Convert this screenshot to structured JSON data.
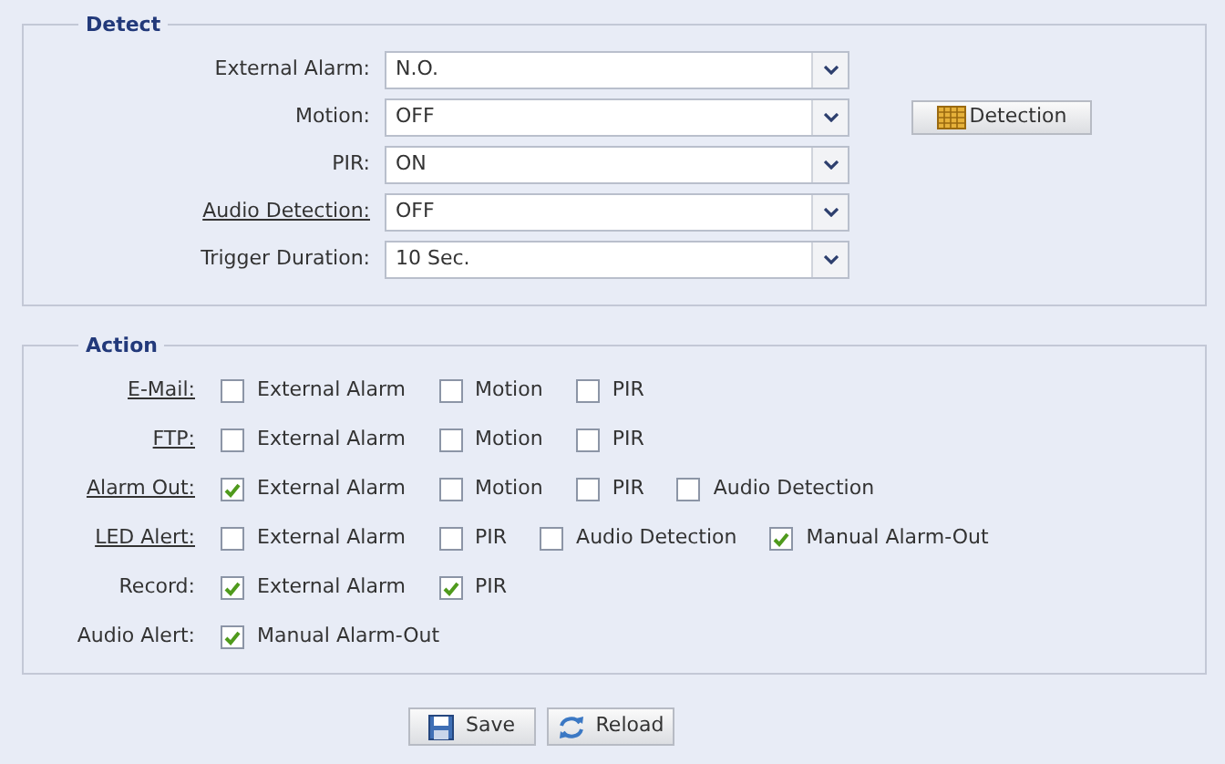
{
  "detect": {
    "legend": "Detect",
    "fields": [
      {
        "label": "External Alarm:",
        "link": false,
        "value": "N.O."
      },
      {
        "label": "Motion:",
        "link": false,
        "value": "OFF"
      },
      {
        "label": "PIR:",
        "link": false,
        "value": "ON"
      },
      {
        "label": "Audio Detection:",
        "link": true,
        "value": "OFF"
      },
      {
        "label": "Trigger Duration:",
        "link": false,
        "value": "10 Sec."
      }
    ],
    "detection_button": "Detection"
  },
  "action": {
    "legend": "Action",
    "rows": [
      {
        "label": "E-Mail:",
        "link": true,
        "options": [
          {
            "label": "External Alarm",
            "checked": false
          },
          {
            "label": "Motion",
            "checked": false
          },
          {
            "label": "PIR",
            "checked": false
          }
        ]
      },
      {
        "label": "FTP:",
        "link": true,
        "options": [
          {
            "label": "External Alarm",
            "checked": false
          },
          {
            "label": "Motion",
            "checked": false
          },
          {
            "label": "PIR",
            "checked": false
          }
        ]
      },
      {
        "label": "Alarm Out:",
        "link": true,
        "options": [
          {
            "label": "External Alarm",
            "checked": true
          },
          {
            "label": "Motion",
            "checked": false
          },
          {
            "label": "PIR",
            "checked": false
          },
          {
            "label": "Audio Detection",
            "checked": false
          }
        ]
      },
      {
        "label": "LED Alert:",
        "link": true,
        "options": [
          {
            "label": "External Alarm",
            "checked": false
          },
          {
            "label": "PIR",
            "checked": false
          },
          {
            "label": "Audio Detection",
            "checked": false
          },
          {
            "label": "Manual Alarm-Out",
            "checked": true
          }
        ]
      },
      {
        "label": "Record:",
        "link": false,
        "options": [
          {
            "label": "External Alarm",
            "checked": true
          },
          {
            "label": "PIR",
            "checked": true
          }
        ]
      },
      {
        "label": "Audio Alert:",
        "link": false,
        "options": [
          {
            "label": "Manual Alarm-Out",
            "checked": true
          }
        ]
      }
    ]
  },
  "buttons": [
    {
      "label": "Save",
      "kind": "save"
    },
    {
      "label": "Reload",
      "kind": "reload"
    }
  ]
}
